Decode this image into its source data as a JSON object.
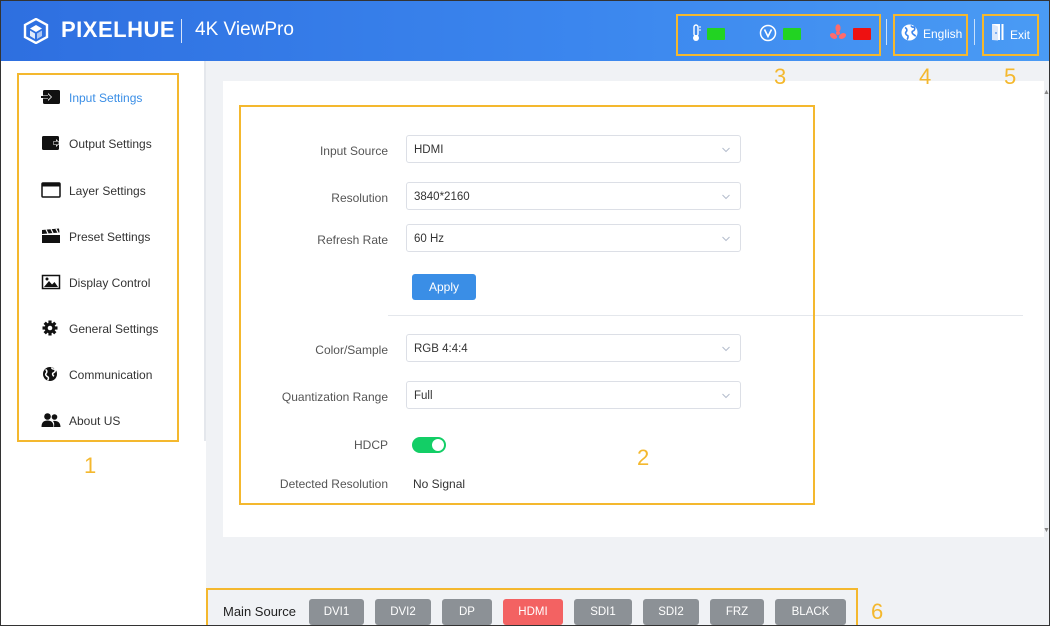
{
  "header": {
    "brand": "PIXELHUE",
    "product": "4K ViewPro",
    "status": [
      {
        "icon": "thermometer-icon",
        "color": "#22d322"
      },
      {
        "icon": "voltage-icon",
        "color": "#22d322"
      },
      {
        "icon": "fan-icon",
        "color": "#ee1111"
      }
    ],
    "language": "English",
    "exit": "Exit"
  },
  "sidebar": {
    "items": [
      {
        "label": "Input Settings",
        "icon": "input-icon",
        "active": true
      },
      {
        "label": "Output Settings",
        "icon": "output-icon"
      },
      {
        "label": "Layer Settings",
        "icon": "layer-icon"
      },
      {
        "label": "Preset Settings",
        "icon": "preset-icon"
      },
      {
        "label": "Display Control",
        "icon": "image-icon"
      },
      {
        "label": "General Settings",
        "icon": "gear-icon"
      },
      {
        "label": "Communication",
        "icon": "globe-icon"
      },
      {
        "label": "About US",
        "icon": "users-icon"
      }
    ]
  },
  "form": {
    "input_source": {
      "label": "Input Source",
      "value": "HDMI"
    },
    "resolution": {
      "label": "Resolution",
      "value": "3840*2160"
    },
    "refresh_rate": {
      "label": "Refresh Rate",
      "value": "60 Hz"
    },
    "apply": "Apply",
    "color_sample": {
      "label": "Color/Sample",
      "value": "RGB 4:4:4"
    },
    "quantization": {
      "label": "Quantization Range",
      "value": "Full"
    },
    "hdcp": {
      "label": "HDCP",
      "enabled": true
    },
    "detected_resolution": {
      "label": "Detected Resolution",
      "value": "No Signal"
    }
  },
  "sources": {
    "label": "Main Source",
    "buttons": [
      "DVI1",
      "DVI2",
      "DP",
      "HDMI",
      "SDI1",
      "SDI2",
      "FRZ",
      "BLACK"
    ],
    "active": "HDMI"
  },
  "annotations": [
    "1",
    "2",
    "3",
    "4",
    "5",
    "6"
  ],
  "colors": {
    "header_start": "#2e6fe0",
    "header_end": "#4a9bf4",
    "accent": "#3a8ee6",
    "annotation": "#f4b82e",
    "active_source": "#f36262",
    "source_button": "#8c9196",
    "toggle_on": "#13ce66"
  }
}
